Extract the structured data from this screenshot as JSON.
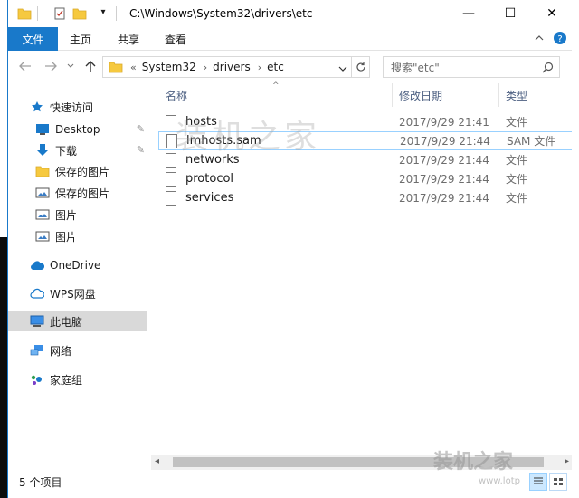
{
  "titlebar": {
    "path": "C:\\Windows\\System32\\drivers\\etc",
    "minimize": "—",
    "maximize": "☐",
    "close": "✕"
  },
  "ribbon": {
    "tabs": [
      "文件",
      "主页",
      "共享",
      "查看"
    ]
  },
  "address": {
    "prefix": "«",
    "crumbs": [
      "System32",
      "drivers",
      "etc"
    ],
    "search_placeholder": "搜索\"etc\""
  },
  "navpane": {
    "items": [
      {
        "label": "快速访问",
        "icon": "star-icon"
      },
      {
        "label": "Desktop",
        "icon": "desktop-icon"
      },
      {
        "label": "下载",
        "icon": "download-arrow-icon"
      },
      {
        "label": "保存的图片",
        "icon": "folder-icon"
      },
      {
        "label": "保存的图片",
        "icon": "picture-icon"
      },
      {
        "label": "图片",
        "icon": "picture-icon"
      },
      {
        "label": "图片",
        "icon": "picture-icon"
      },
      {
        "label": "OneDrive",
        "icon": "cloud-icon"
      },
      {
        "label": "WPS网盘",
        "icon": "cloud-outline-icon"
      },
      {
        "label": "此电脑",
        "icon": "computer-icon"
      },
      {
        "label": "网络",
        "icon": "network-icon"
      },
      {
        "label": "家庭组",
        "icon": "homegroup-icon"
      }
    ]
  },
  "filelist": {
    "columns": [
      "名称",
      "修改日期",
      "类型"
    ],
    "rows": [
      {
        "name": "hosts",
        "date": "2017/9/29 21:41",
        "type": "文件"
      },
      {
        "name": "lmhosts.sam",
        "date": "2017/9/29 21:44",
        "type": "SAM 文件"
      },
      {
        "name": "networks",
        "date": "2017/9/29 21:44",
        "type": "文件"
      },
      {
        "name": "protocol",
        "date": "2017/9/29 21:44",
        "type": "文件"
      },
      {
        "name": "services",
        "date": "2017/9/29 21:44",
        "type": "文件"
      }
    ]
  },
  "watermark": "装机之家",
  "status": {
    "count": "5 个项目"
  },
  "logo": {
    "text": "装机之家",
    "site": "www.lotp"
  },
  "colors": {
    "accent": "#1979ca",
    "selected": "#d9d9d9",
    "hover": "#cce8ff"
  }
}
